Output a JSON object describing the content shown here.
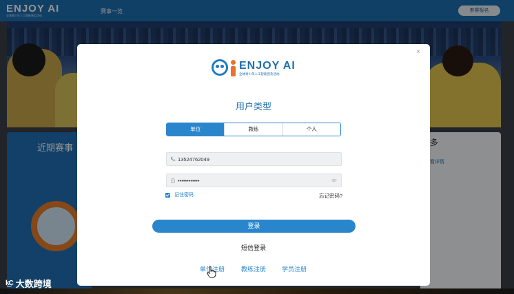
{
  "site": {
    "logo": "ENJOY AI",
    "logo_sub": "全球青少年人工智能普及活动",
    "nav_item": "赛事一览",
    "signup_button": "参赛报名"
  },
  "left_panel": {
    "title": "近期赛事"
  },
  "right_panel": {
    "title": "多",
    "link": "看详情"
  },
  "modal": {
    "brand": {
      "name": "ENJOY AI",
      "tagline": "全球青少年人工智能普及活动"
    },
    "title": "用户类型",
    "segments": [
      {
        "label": "单位",
        "active": true
      },
      {
        "label": "教练",
        "active": false
      },
      {
        "label": "个人",
        "active": false
      }
    ],
    "phone": {
      "value": "13524762049",
      "icon": "phone-icon"
    },
    "password": {
      "value": "••••••••••••",
      "icon": "lock-icon"
    },
    "remember_label": "记住密码",
    "remember_checked": true,
    "forgot_label": "忘记密码?",
    "login_label": "登录",
    "sms_label": "短信登录",
    "register_links": [
      "单位注册",
      "教练注册",
      "学员注册"
    ],
    "close_label": "×"
  },
  "watermark": {
    "mark": "k͜C",
    "text": "大数跨境"
  },
  "colors": {
    "brand_blue": "#1e6fb0",
    "accent_blue": "#2a86cc",
    "orange": "#e8742a"
  }
}
